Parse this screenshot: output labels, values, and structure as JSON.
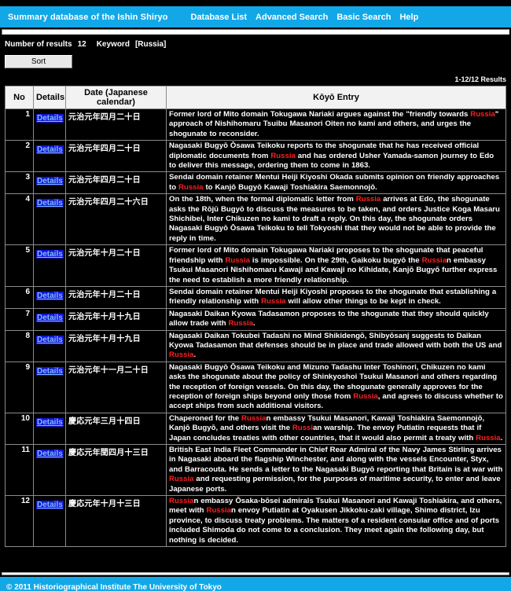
{
  "nav": {
    "brand": "Summary database of the Ishin Shiryo",
    "links": [
      {
        "label": "Database List"
      },
      {
        "label": "Advanced Search"
      },
      {
        "label": "Basic Search"
      },
      {
        "label": "Help"
      }
    ]
  },
  "summary": {
    "results_label": "Number of results",
    "results_count": "12",
    "keyword_label": "Keyword",
    "keyword_value": "[Russia]"
  },
  "controls": {
    "sort_label": "Sort"
  },
  "pager": {
    "range": "1-12/12 Results"
  },
  "table": {
    "headers": {
      "no": "No",
      "details": "Details",
      "date": "Date (Japanese calendar)",
      "entry": "Kōyō Entry"
    },
    "details_link_label": "Details",
    "highlight_color": "#ff2020",
    "rows": [
      {
        "no": "1",
        "details": "Details",
        "date": "元治元年四月二十日",
        "entry_parts": [
          {
            "text": "Former lord of Mito domain Tokugawa Nariaki argues against the \"friendly towards ",
            "hl": false
          },
          {
            "text": "Russia",
            "hl": true
          },
          {
            "text": "\" approach of Nishihomaru Tsuibu Masanori Oiten no kami and others, and urges the shogunate to reconsider.",
            "hl": false
          }
        ]
      },
      {
        "no": "2",
        "details": "Details",
        "date": "元治元年四月二十日",
        "entry_parts": [
          {
            "text": "Nagasaki Bugyō Ōsawa Teikoku reports to the shogunate that he has received official diplomatic documents from ",
            "hl": false
          },
          {
            "text": "Russia",
            "hl": true
          },
          {
            "text": " and has ordered Usher Yamada-samon journey to Edo to deliver this message, ordering them to come in 1863.",
            "hl": false
          }
        ]
      },
      {
        "no": "3",
        "details": "Details",
        "date": "元治元年四月二十日",
        "entry_parts": [
          {
            "text": "Sendai domain retainer Mentui Heiji Kiyoshi Okada submits opinion on friendly approaches to ",
            "hl": false
          },
          {
            "text": "Russia",
            "hl": true
          },
          {
            "text": " to Kanjō Bugyō Kawaji Toshiakira Saemonnojō.",
            "hl": false
          }
        ]
      },
      {
        "no": "4",
        "details": "Details",
        "date": "元治元年四月二十六日",
        "entry_parts": [
          {
            "text": "On the 18th, when the formal diplomatic letter from ",
            "hl": false
          },
          {
            "text": "Russia",
            "hl": true
          },
          {
            "text": " arrives at Edo, the shogunate asks the Rōjū Bugyō to discuss the measures to be taken, and orders Justice Koga Masaru Shichibei, Inter Chikuzen no kami to draft a reply. On this day, the shogunate orders Nagasaki Bugyō Ōsawa Teikoku to tell Tokyoshi that they would not be able to provide the reply in time.",
            "hl": false
          }
        ]
      },
      {
        "no": "5",
        "details": "Details",
        "date": "元治元年十月二十日",
        "entry_parts": [
          {
            "text": "Former lord of Mito domain Tokugawa Nariaki proposes to the shogunate that peaceful friendship with ",
            "hl": false
          },
          {
            "text": "Russia",
            "hl": true
          },
          {
            "text": " is impossible. On the 29th, Gaikoku bugyō the ",
            "hl": false
          },
          {
            "text": "Russia",
            "hl": true
          },
          {
            "text": "n embassy Tsukui Masanori Nishihomaru Kawaji and Kawaji no Kihidate, Kanjō Bugyō further express the need to establish a more friendly relationship.",
            "hl": false
          }
        ]
      },
      {
        "no": "6",
        "details": "Details",
        "date": "元治元年十月二十日",
        "entry_parts": [
          {
            "text": "Sendai domain retainer Mentui Heiji Kiyoshi proposes to the shogunate that establishing a friendly relationship with ",
            "hl": false
          },
          {
            "text": "Russia",
            "hl": true
          },
          {
            "text": " will allow other things to be kept in check.",
            "hl": false
          }
        ]
      },
      {
        "no": "7",
        "details": "Details",
        "date": "元治元年十月十九日",
        "entry_parts": [
          {
            "text": "Nagasaki Daikan Kyowa Tadasamon proposes to the shogunate that they should quickly allow trade with ",
            "hl": false
          },
          {
            "text": "Russia",
            "hl": true
          },
          {
            "text": ".",
            "hl": false
          }
        ]
      },
      {
        "no": "8",
        "details": "Details",
        "date": "元治元年十月十九日",
        "entry_parts": [
          {
            "text": "Nagasaki Daikan Tokubei Tadashi no Mind Shikidengō, Shibyōsanj suggests to Daikan Kyowa Tadasamon that defenses should be in place and trade allowed with both the US and ",
            "hl": false
          },
          {
            "text": "Russia",
            "hl": true
          },
          {
            "text": ".",
            "hl": false
          }
        ]
      },
      {
        "no": "9",
        "details": "Details",
        "date": "元治元年十一月二十日",
        "entry_parts": [
          {
            "text": "Nagasaki Bugyō Ōsawa Teikoku and Mizuno Tadashu Inter Toshinori, Chikuzen no kami asks the shogunate about the policy of Shinkyoshoi Tsukui Masanori and others regarding the reception of foreign vessels. On this day, the shogunate generally approves for the reception of foreign ships beyond only those from ",
            "hl": false
          },
          {
            "text": "Russia",
            "hl": true
          },
          {
            "text": ", and agrees to discuss whether to accept ships from such additional visitors.",
            "hl": false
          }
        ]
      },
      {
        "no": "10",
        "details": "Details",
        "date": "慶応元年三月十四日",
        "entry_parts": [
          {
            "text": "Chaperoned for the ",
            "hl": false
          },
          {
            "text": "Russia",
            "hl": true
          },
          {
            "text": "n embassy Tsukui Masanori, Kawaji Toshiakira Saemonnojō, Kanjō Bugyō, and others visit the ",
            "hl": false
          },
          {
            "text": "Russi",
            "hl": true
          },
          {
            "text": "an warship. The envoy Putiatin requests that if Japan concludes treaties with other countries, that it would also permit a treaty with ",
            "hl": false
          },
          {
            "text": "Russia",
            "hl": true
          },
          {
            "text": ".",
            "hl": false
          }
        ]
      },
      {
        "no": "11",
        "details": "Details",
        "date": "慶応元年閏四月十三日",
        "entry_parts": [
          {
            "text": "British East India Fleet Commander in Chief Rear Admiral of the Navy James Stirling arrives in Nagasaki aboard the flagship Winchester, and along with the vessels Encounter, Styx, and Barracouta. He sends a letter to the Nagasaki Bugyō reporting that Britain is at war with ",
            "hl": false
          },
          {
            "text": "Russia",
            "hl": true
          },
          {
            "text": " and requesting permission, for the purposes of maritime security, to enter and leave Japanese ports.",
            "hl": false
          }
        ]
      },
      {
        "no": "12",
        "details": "Details",
        "date": "慶応元年十月十三日",
        "entry_parts": [
          {
            "text": "Russia",
            "hl": true
          },
          {
            "text": "n embassy Ōsaka-bōsei admirals Tsukui Masanori and Kawaji Toshiakira, and others, meet with ",
            "hl": false
          },
          {
            "text": "Russia",
            "hl": true
          },
          {
            "text": "n envoy Putiatin at Oyakusen Jikkoku-zaki village, Shimo district, Izu province, to discuss treaty problems. The matters of a resident consular office and of ports included Shimoda do not come to a conclusion. They meet again the following day, but nothing is decided.",
            "hl": false
          }
        ]
      }
    ]
  },
  "footer": {
    "copyright": "© 2011 Historiographical Institute The University of Tokyo"
  }
}
